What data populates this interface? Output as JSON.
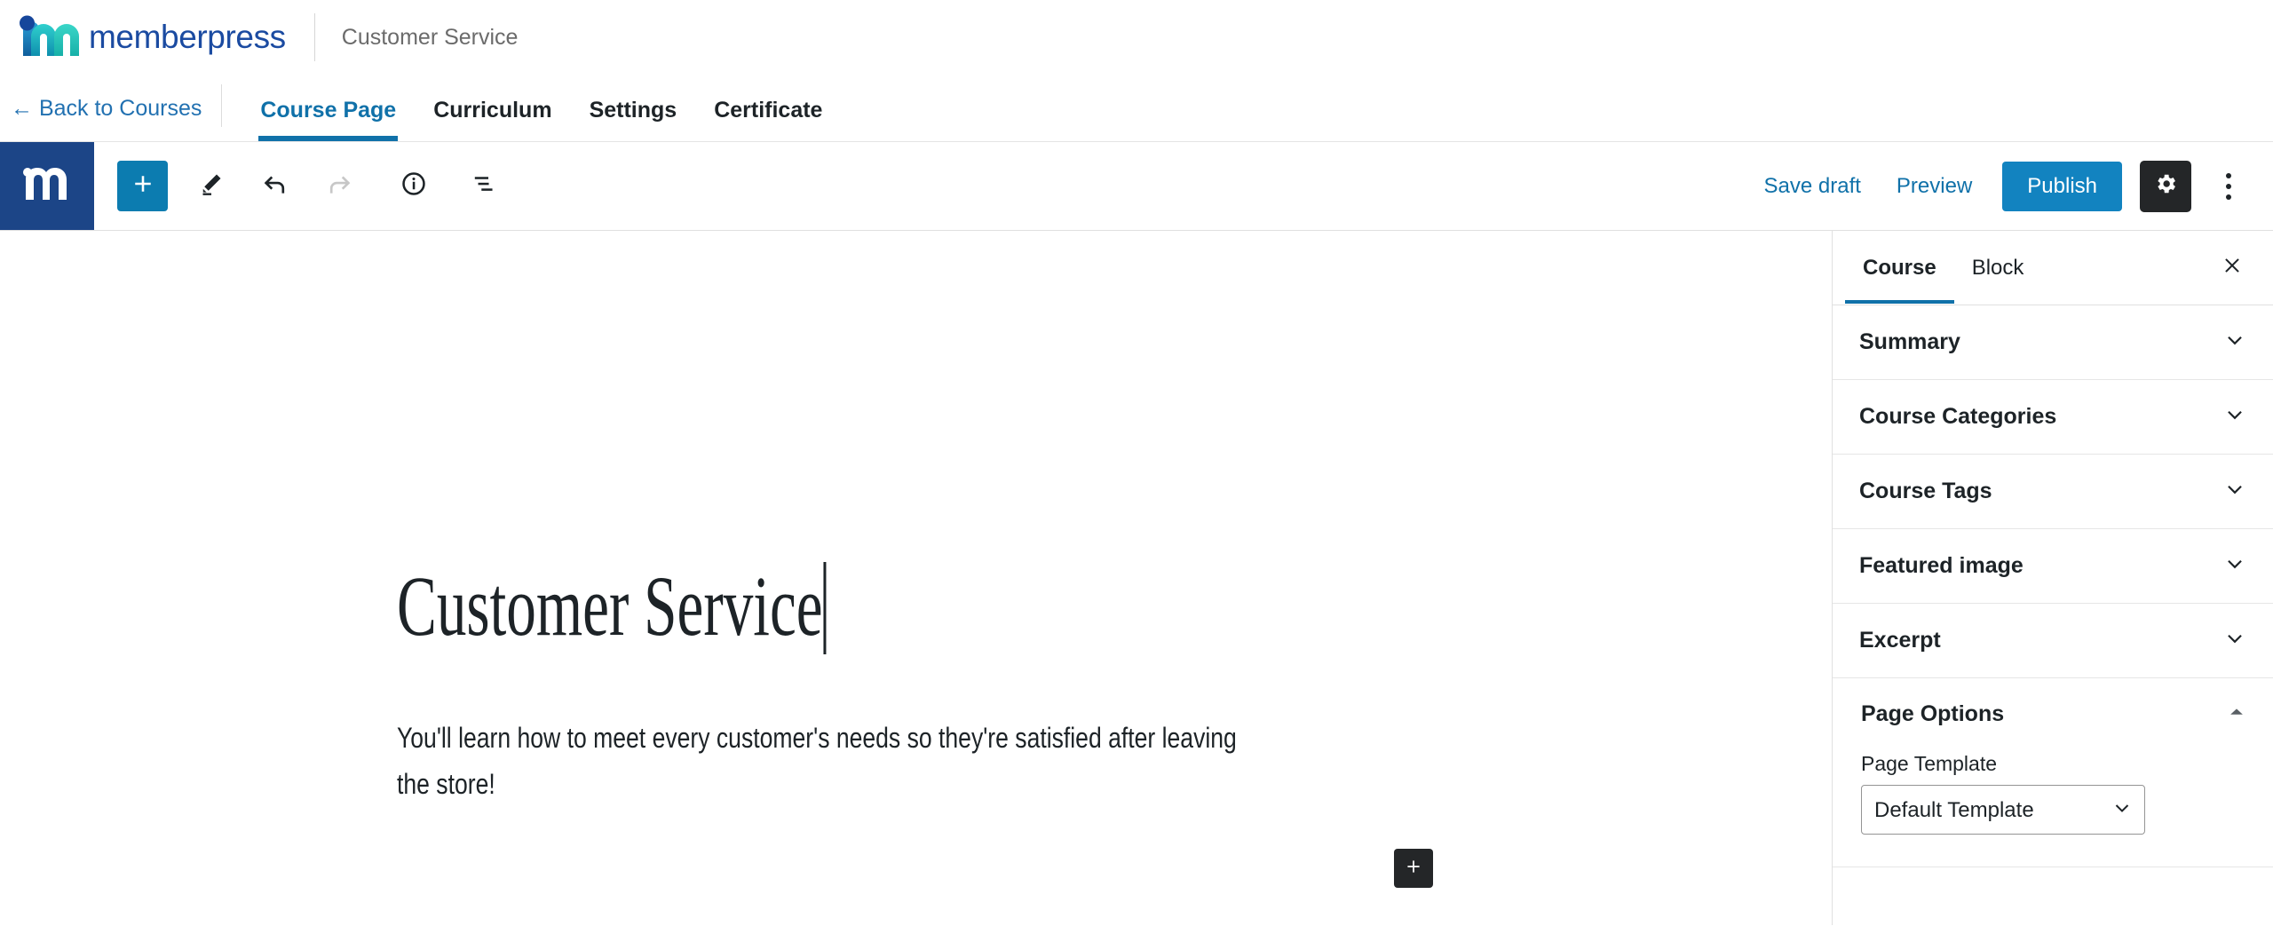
{
  "brand": {
    "wordmark": "memberpress",
    "logo_icon": "memberpress-m-logo",
    "course_name": "Customer Service"
  },
  "nav": {
    "back_label": "← Back to Courses",
    "tabs": [
      {
        "label": "Course Page",
        "active": true
      },
      {
        "label": "Curriculum",
        "active": false
      },
      {
        "label": "Settings",
        "active": false
      },
      {
        "label": "Certificate",
        "active": false
      }
    ]
  },
  "toolbar": {
    "mp_square_icon": "memberpress-m-mark",
    "add_block_icon": "plus-icon",
    "tools_icon": "pencil-icon",
    "undo_icon": "undo-arrow-icon",
    "redo_icon": "redo-arrow-icon",
    "details_icon": "info-circle-icon",
    "list_view_icon": "list-view-icon",
    "save_draft_label": "Save draft",
    "preview_label": "Preview",
    "publish_label": "Publish",
    "settings_icon": "gear-icon",
    "more_icon": "kebab-menu-icon"
  },
  "editor": {
    "title": "Customer Service",
    "paragraph": "You'll learn how to meet every customer's needs so they're satisfied after leaving the store!",
    "inserter_icon": "plus-icon"
  },
  "sidebar": {
    "tabs": [
      {
        "label": "Course",
        "active": true
      },
      {
        "label": "Block",
        "active": false
      }
    ],
    "close_icon": "close-icon",
    "panels": [
      {
        "title": "Summary",
        "expanded": false,
        "chevron": "chevron-down-icon"
      },
      {
        "title": "Course Categories",
        "expanded": false,
        "chevron": "chevron-down-icon"
      },
      {
        "title": "Course Tags",
        "expanded": false,
        "chevron": "chevron-down-icon"
      },
      {
        "title": "Featured image",
        "expanded": false,
        "chevron": "chevron-down-icon"
      },
      {
        "title": "Excerpt",
        "expanded": false,
        "chevron": "chevron-down-icon"
      },
      {
        "title": "Page Options",
        "expanded": true,
        "chevron": "chevron-up-icon"
      }
    ],
    "page_options": {
      "field_label": "Page Template",
      "selected": "Default Template",
      "options": [
        "Default Template"
      ],
      "chevron": "chevron-down-icon"
    }
  },
  "colors": {
    "brand_blue": "#1b4ba1",
    "accent_blue": "#1071a9",
    "publish_blue": "#1283c0",
    "mp_square": "#1c4587",
    "dark_button": "#242628",
    "link_blue": "#2271b1"
  }
}
